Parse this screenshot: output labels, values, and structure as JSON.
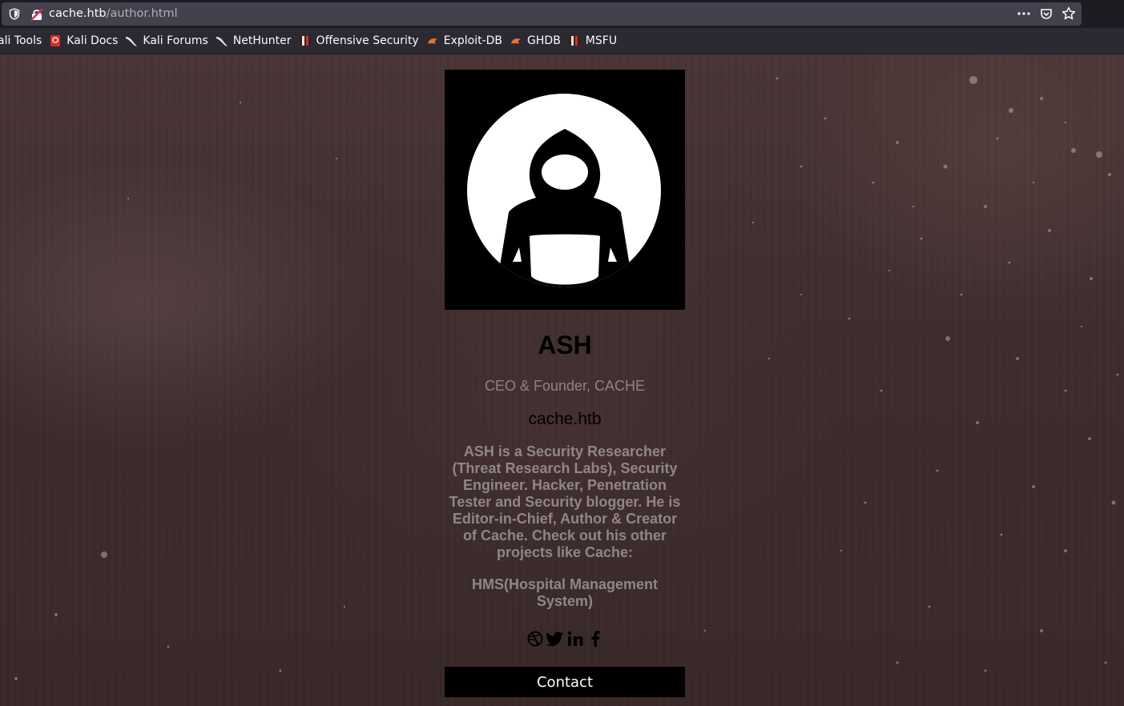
{
  "browser": {
    "url_host": "cache.htb",
    "url_path": "/author.html",
    "bookmarks": [
      {
        "label": "ali Tools",
        "icon": "kali-icon"
      },
      {
        "label": "Kali Docs",
        "icon": "kali-docs-icon"
      },
      {
        "label": "Kali Forums",
        "icon": "kali-dragon-icon"
      },
      {
        "label": "NetHunter",
        "icon": "kali-dragon-icon"
      },
      {
        "label": "Offensive Security",
        "icon": "offsec-icon"
      },
      {
        "label": "Exploit-DB",
        "icon": "exploit-db-icon"
      },
      {
        "label": "GHDB",
        "icon": "ghdb-icon"
      },
      {
        "label": "MSFU",
        "icon": "msfu-icon"
      }
    ]
  },
  "profile": {
    "name": "ASH",
    "role": "CEO & Founder, CACHE",
    "site": "cache.htb",
    "bio": "ASH is a Security Researcher (Threat Research Labs), Security Engineer. Hacker, Penetration Tester and Security blogger. He is Editor-in-Chief, Author & Creator of Cache. Check out his other projects like Cache:",
    "project": "HMS(Hospital Management System)",
    "social": [
      "dribbble-icon",
      "twitter-icon",
      "linkedin-icon",
      "facebook-icon"
    ],
    "contact_label": "Contact"
  },
  "colors": {
    "page_bg": "#3e2d2d",
    "text_muted": "#8e8789",
    "button_bg": "#000000"
  }
}
